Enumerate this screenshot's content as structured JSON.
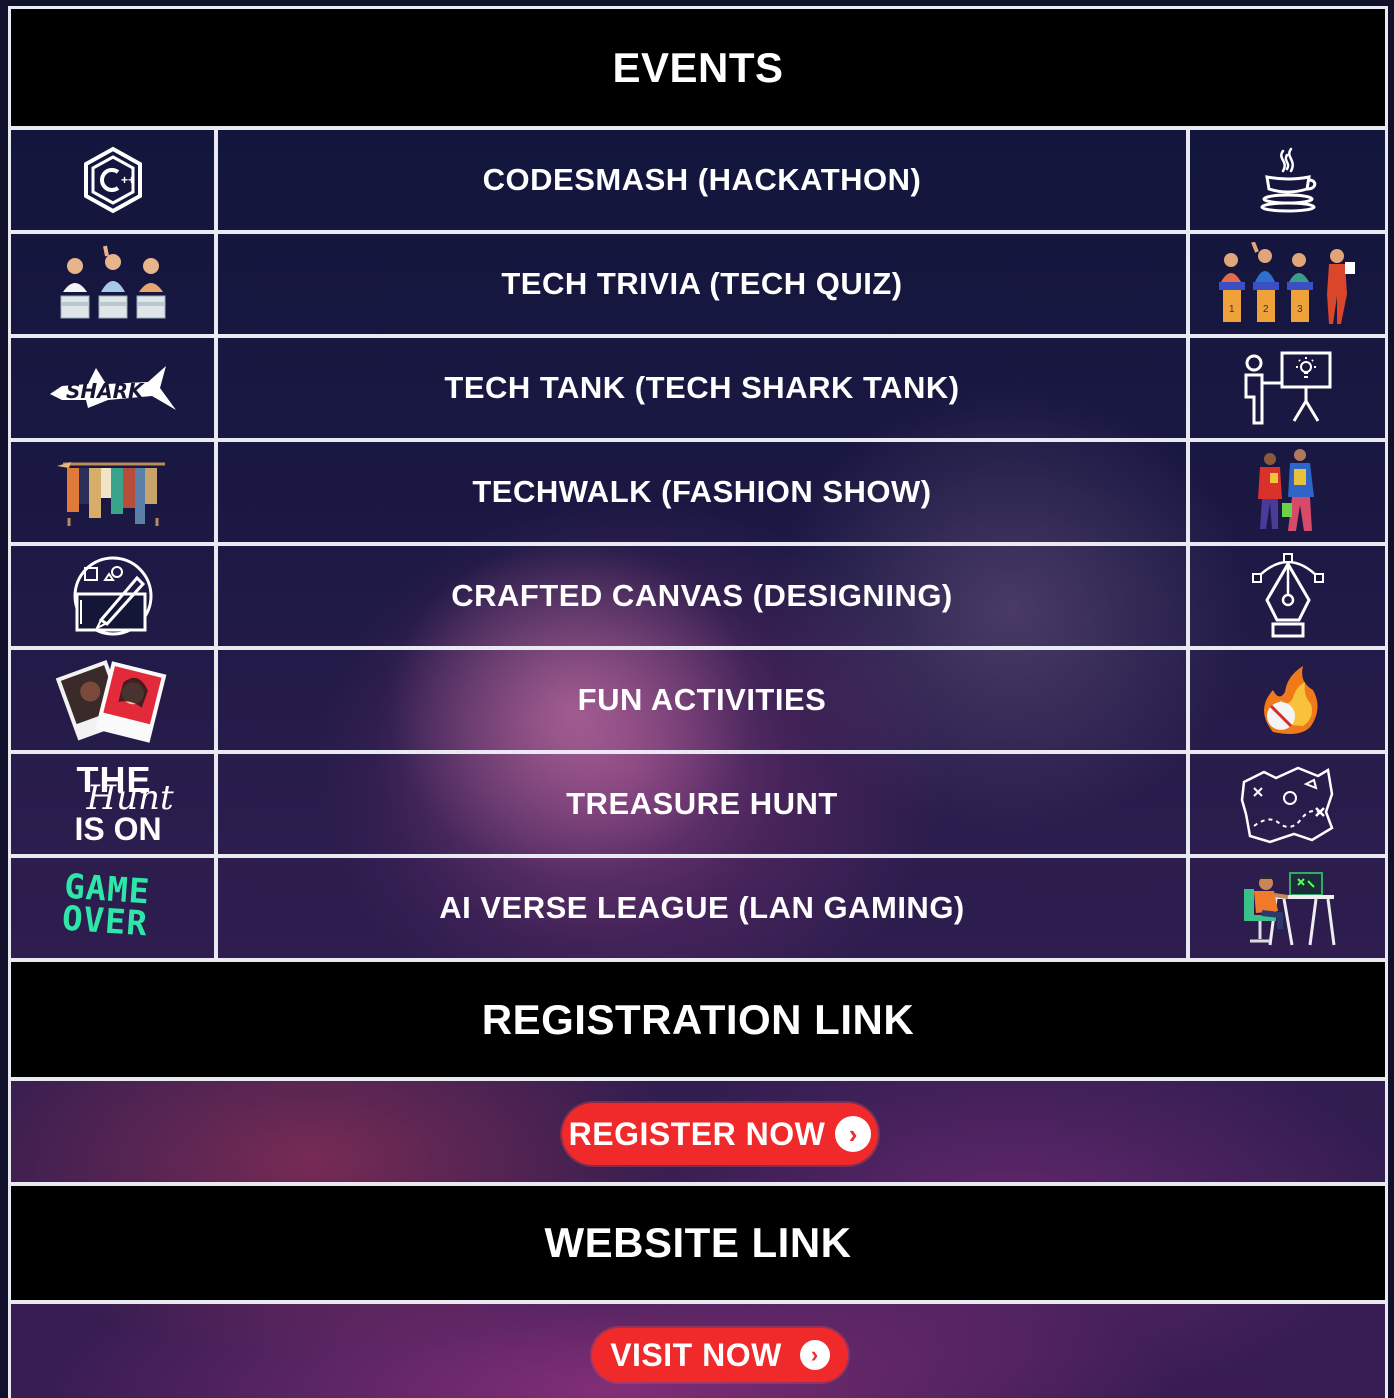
{
  "header": {
    "title": "EVENTS"
  },
  "events": [
    {
      "name": "CODESMASH (HACKATHON)",
      "left_icon": "cpp-logo-icon",
      "right_icon": "java-logo-icon"
    },
    {
      "name": "TECH TRIVIA (TECH QUIZ)",
      "left_icon": "quiz-contestants-icon",
      "right_icon": "quiz-podium-icon"
    },
    {
      "name": "TECH TANK (TECH SHARK TANK)",
      "left_icon": "shark-logo-icon",
      "right_icon": "presentation-icon"
    },
    {
      "name": "TECHWALK (FASHION SHOW)",
      "left_icon": "clothes-rack-icon",
      "right_icon": "fashion-models-icon"
    },
    {
      "name": "CRAFTED CANVAS (DESIGNING)",
      "left_icon": "design-tablet-icon",
      "right_icon": "pen-tool-icon"
    },
    {
      "name": "FUN ACTIVITIES",
      "left_icon": "polaroid-photos-icon",
      "right_icon": "fire-cricket-ball-icon"
    },
    {
      "name": "TREASURE HUNT",
      "left_icon": "the-hunt-is-on-icon",
      "right_icon": "treasure-map-icon"
    },
    {
      "name": "AI VERSE LEAGUE (LAN GAMING)",
      "left_icon": "game-over-icon",
      "right_icon": "gamer-desk-icon"
    }
  ],
  "icon_text": {
    "hunt_line1": "THE",
    "hunt_script": "Hunt",
    "hunt_line2": "IS ON",
    "game_line1": "GAME",
    "game_line2": "OVER",
    "shark": "SHARK"
  },
  "registration": {
    "title": "REGISTRATION LINK",
    "button": "REGISTER NOW"
  },
  "website": {
    "title": "WEBSITE LINK",
    "button": "VISIT NOW"
  },
  "colors": {
    "button": "#f02a2a",
    "band": "#000000",
    "border": "#e9e9f2",
    "game_over": "#2ee6a8"
  }
}
